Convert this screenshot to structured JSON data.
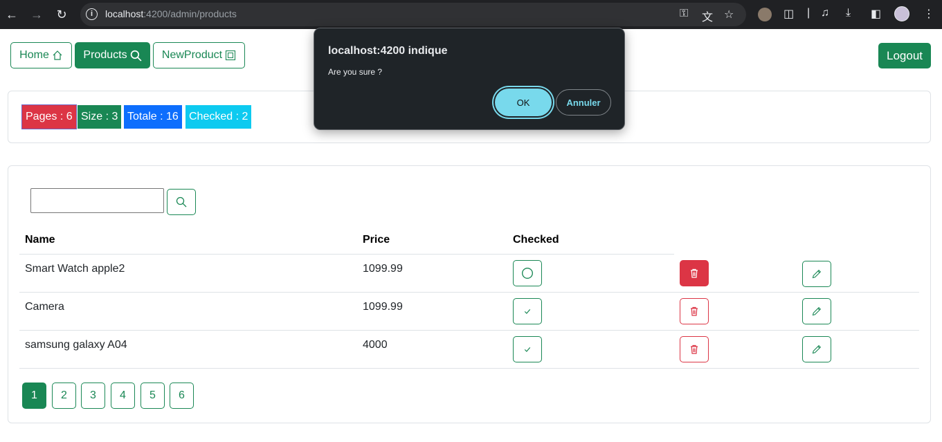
{
  "browser": {
    "url_host": "localhost",
    "url_rest": ":4200/admin/products",
    "icons": [
      "back-icon",
      "forward-icon",
      "reload-icon",
      "site-info-icon",
      "key-icon",
      "translate-icon",
      "star-icon",
      "extension-icon",
      "media-icon",
      "download-icon",
      "sidebar-icon",
      "menu-icon"
    ]
  },
  "nav": {
    "home_label": "Home",
    "products_label": "Products",
    "newproduct_label": "NewProduct",
    "logout_label": "Logout"
  },
  "badges": {
    "pages": "Pages : 6",
    "size": "Size : 3",
    "total": "Totale : 16",
    "checked": "Checked : 2"
  },
  "colors": {
    "primary_green": "#198754",
    "danger_red": "#dc3545",
    "primary_blue": "#0d6efd",
    "info_cyan": "#0dcaf0"
  },
  "search": {
    "value": ""
  },
  "table": {
    "headers": [
      "Name",
      "Price",
      "Checked"
    ],
    "rows": [
      {
        "name": "Smart Watch apple2",
        "price": "1099.99",
        "checked": false
      },
      {
        "name": "Camera",
        "price": "1099.99",
        "checked": true
      },
      {
        "name": "samsung galaxy A04",
        "price": "4000",
        "checked": true
      }
    ]
  },
  "pagination": {
    "pages": [
      "1",
      "2",
      "3",
      "4",
      "5",
      "6"
    ],
    "current": "1"
  },
  "dialog": {
    "title": "localhost:4200 indique",
    "message": "Are you sure ?",
    "ok_label": "OK",
    "cancel_label": "Annuler"
  }
}
